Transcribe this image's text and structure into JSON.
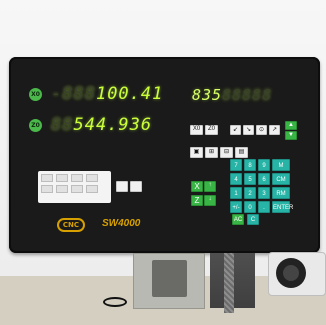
{
  "panel": {
    "x_axis_label": "X0",
    "z_axis_label": "Z0",
    "x_value": "100.41",
    "z_value": "544.936",
    "ghost_x": "-888",
    "ghost_z": "88",
    "top_right_readout": "835",
    "brand": "SW4000",
    "brand_logo_text": "CNC",
    "right_keys": {
      "row1": [
        "X0",
        "Z0"
      ],
      "row2": [
        "↙",
        "↘",
        "⊙",
        "↗"
      ],
      "row3": [
        "▲",
        "▼"
      ],
      "row4": [
        "▣",
        "⊞",
        "⊟",
        "▤"
      ],
      "axis_keys": [
        "X",
        "Z"
      ],
      "arrows": [
        "↑",
        "↓"
      ],
      "number_pad": [
        [
          "7",
          "8",
          "9",
          "M"
        ],
        [
          "4",
          "5",
          "6",
          "CM"
        ],
        [
          "1",
          "2",
          "3",
          "RM"
        ],
        [
          "+/-",
          "0",
          ".",
          "ENTER"
        ]
      ],
      "bottom_ac": "AC",
      "bottom_c": "C"
    }
  }
}
